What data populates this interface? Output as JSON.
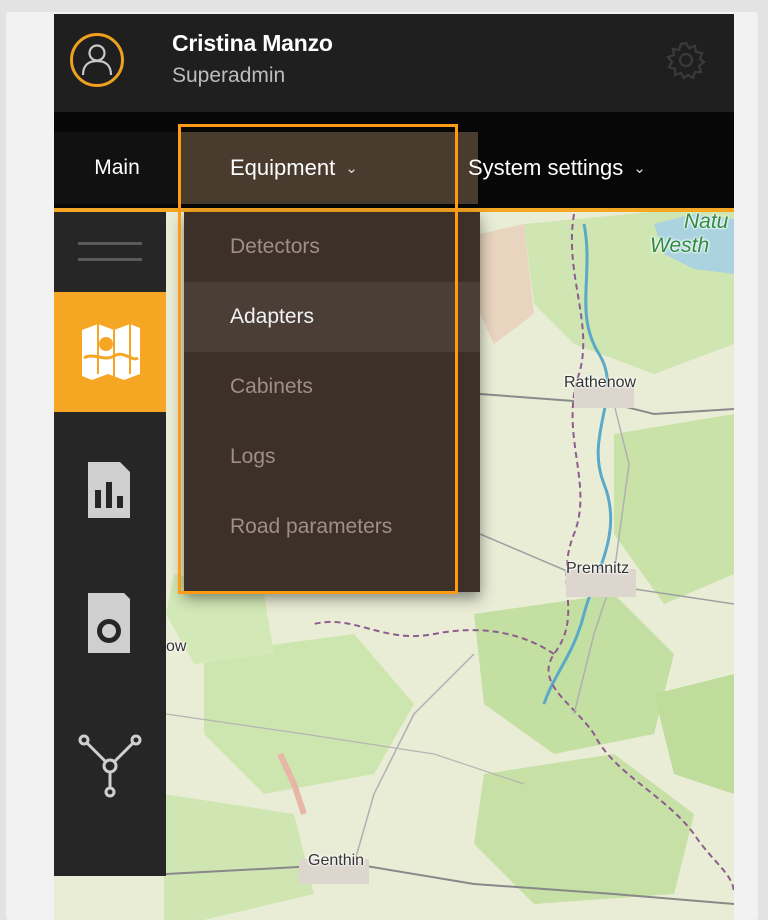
{
  "user": {
    "name": "Cristina Manzo",
    "role": "Superadmin"
  },
  "nav": {
    "main_label": "Main",
    "equipment_label": "Equipment",
    "system_label": "System settings"
  },
  "dropdown": {
    "items": [
      {
        "label": "Detectors",
        "active": false
      },
      {
        "label": "Adapters",
        "active": true
      },
      {
        "label": "Cabinets",
        "active": false
      },
      {
        "label": "Logs",
        "active": false
      },
      {
        "label": "Road parameters",
        "active": false
      }
    ]
  },
  "map": {
    "labels": {
      "natur": "Natu",
      "westh": "Westh",
      "rathenow": "Rathenow",
      "premnitz": "Premnitz",
      "ow": "ow",
      "genthin": "Genthin"
    }
  },
  "colors": {
    "accent": "#f5a623",
    "header_bg": "#1f1f1f",
    "nav_bg": "#070707",
    "dropdown_bg": "#3c3029",
    "highlight": "#ff9a14"
  },
  "icons": {
    "avatar": "user-icon",
    "settings": "gear-icon",
    "menu": "hamburger-icon",
    "map": "map-icon",
    "reports": "report-icon",
    "camera": "camera-icon",
    "network": "network-icon",
    "chevron": "chevron-down-icon"
  }
}
